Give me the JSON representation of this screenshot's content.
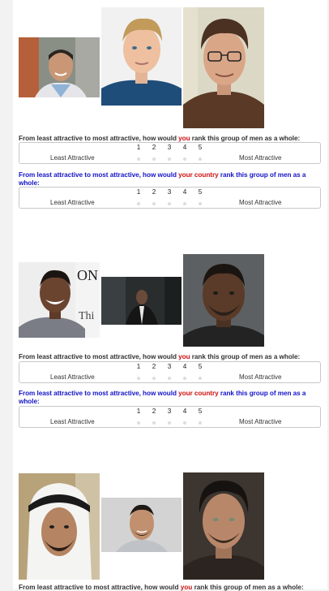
{
  "groups": [
    {
      "photos": [
        {
          "icon": "man-smiling-outdoors-photo"
        },
        {
          "icon": "young-man-blonde-photo"
        },
        {
          "icon": "man-with-glasses-photo"
        }
      ],
      "q_you": {
        "pre": "From least attractive to most attractive, how would ",
        "em": "you",
        "post": " rank this group of men as a whole:"
      },
      "q_country": {
        "pre": "From least attractive to most attractive, how would ",
        "em": "your country",
        "post": " rank this group of men as a whole:"
      }
    },
    {
      "photos": [
        {
          "icon": "man-laughing-photo"
        },
        {
          "icon": "man-in-suit-photo"
        },
        {
          "icon": "bearded-man-photo"
        }
      ],
      "q_you": {
        "pre": "From least attractive to most attractive, how would ",
        "em": "you",
        "post": " rank this group of men as a whole:"
      },
      "q_country": {
        "pre": "From least attractive to most attractive, how would ",
        "em": "your country",
        "post": " rank this group of men as a whole:"
      }
    },
    {
      "photos": [
        {
          "icon": "man-in-headdress-photo"
        },
        {
          "icon": "man-with-beard-smiling-photo"
        },
        {
          "icon": "man-curly-hair-photo"
        }
      ],
      "q_you": {
        "pre": "From least attractive to most attractive, how would ",
        "em": "you",
        "post": " rank this group of men as a whole:"
      }
    }
  ],
  "scale": {
    "numbers": [
      "1",
      "2",
      "3",
      "4",
      "5"
    ],
    "least": "Least Attractive",
    "most": "Most Attractive"
  },
  "colors": {
    "question_dark": "#333333",
    "question_blue": "#1414c8",
    "emphasis_red": "#cc1111",
    "radio_dot": "#dddddd"
  }
}
